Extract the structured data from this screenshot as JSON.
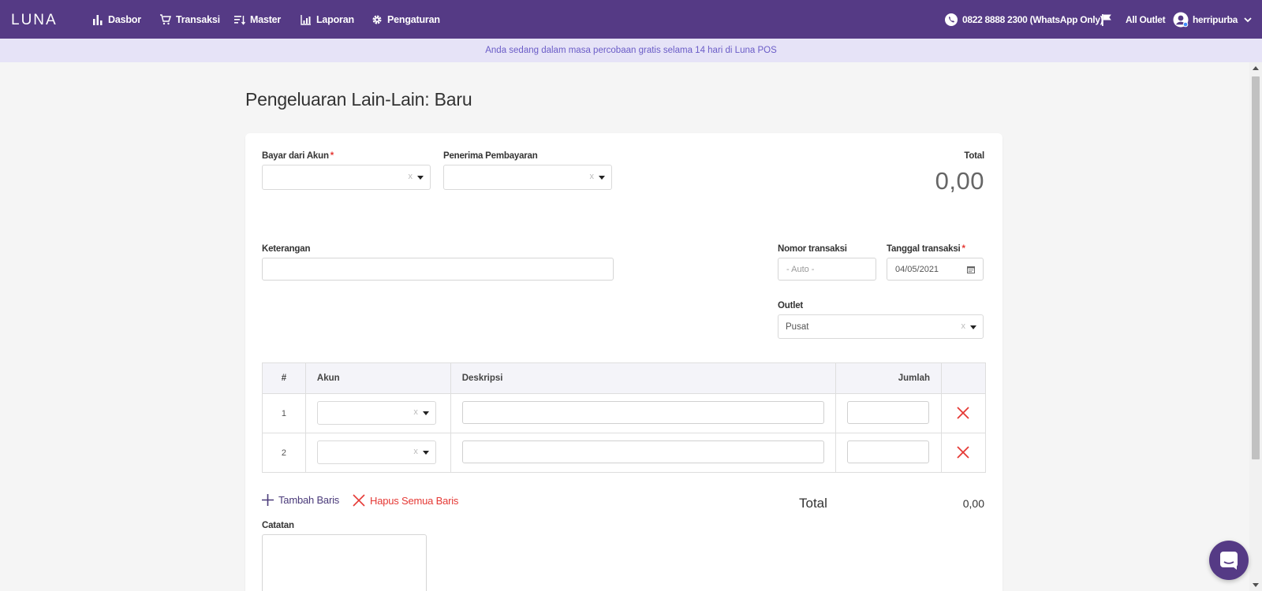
{
  "brand": {
    "logo_text": "LUNA",
    "primary": "#553a85",
    "danger": "#e53935"
  },
  "nav": {
    "items": [
      {
        "label": "Dasbor",
        "icon": "bar-chart-icon"
      },
      {
        "label": "Transaksi",
        "icon": "cart-icon"
      },
      {
        "label": "Master",
        "icon": "list-sort-icon"
      },
      {
        "label": "Laporan",
        "icon": "report-chart-icon"
      },
      {
        "label": "Pengaturan",
        "icon": "gear-icon"
      }
    ],
    "whatsapp": "0822 8888 2300 (WhatsApp Only)",
    "outlet": "All Outlet",
    "user": "herripurba"
  },
  "banner": {
    "text": "Anda sedang dalam masa percobaan gratis selama 14 hari di Luna POS"
  },
  "page": {
    "title": "Pengeluaran Lain-Lain: Baru"
  },
  "form": {
    "pay_from_label": "Bayar dari Akun",
    "payee_label": "Penerima Pembayaran",
    "total_label": "Total",
    "total_value": "0,00",
    "notes_label": "Keterangan",
    "txn_number_label": "Nomor transaksi",
    "txn_number_placeholder": "- Auto -",
    "txn_date_label": "Tanggal transaksi",
    "txn_date_value": "04/05/2021",
    "outlet_label": "Outlet",
    "outlet_value": "Pusat",
    "clear_mark": "x",
    "required_mark": "*"
  },
  "table": {
    "headers": {
      "num": "#",
      "account": "Akun",
      "description": "Deskripsi",
      "amount": "Jumlah"
    },
    "rows": [
      {
        "num": "1"
      },
      {
        "num": "2"
      }
    ]
  },
  "actions": {
    "add_row": "Tambah Baris",
    "delete_all": "Hapus Semua Baris"
  },
  "summary": {
    "total_label": "Total",
    "total_value": "0,00"
  },
  "catatan_label": "Catatan"
}
